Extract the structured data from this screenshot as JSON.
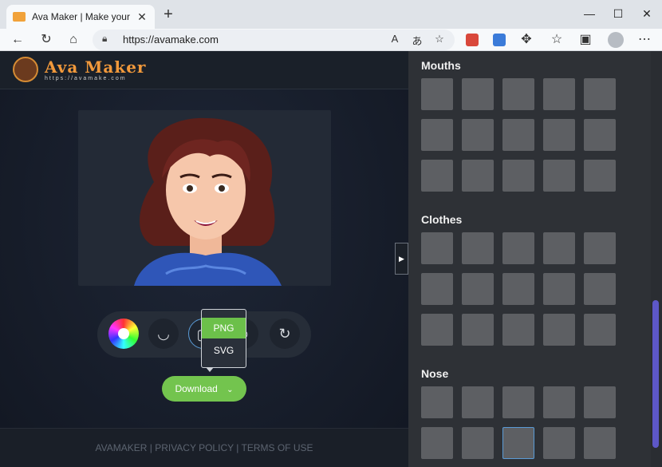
{
  "browser": {
    "tab_title": "Ava Maker | Make your own avat",
    "url": "https://avamake.com"
  },
  "site": {
    "logo_title": "Ava Maker",
    "logo_subtitle": "https://avamake.com"
  },
  "download": {
    "options": [
      "PNG",
      "SVG"
    ],
    "selected": "PNG",
    "button_label": "Download"
  },
  "footer": {
    "links": [
      "AVAMAKER",
      "PRIVACY POLICY",
      "TERMS OF USE"
    ],
    "separator": "|"
  },
  "panel": {
    "sections": [
      {
        "title": "Mouths",
        "rows": 3,
        "cols": 5
      },
      {
        "title": "Clothes",
        "rows": 3,
        "cols": 5
      },
      {
        "title": "Nose",
        "rows": 2,
        "cols": 5
      }
    ],
    "selected_nose_index": 7
  },
  "icons": {
    "back": "back-arrow-icon",
    "refresh": "refresh-icon",
    "home": "home-icon",
    "lock": "lock-icon",
    "tools": [
      "color-wheel-icon",
      "shirt-icon",
      "image-icon",
      "hair-icon",
      "reset-icon"
    ]
  },
  "colors": {
    "download_green": "#73c44e",
    "logo_orange": "#f2993b",
    "panel_bg": "#2e3136",
    "swatch_bg": "#5d5f63",
    "scroll_thumb": "#5d57c7"
  }
}
